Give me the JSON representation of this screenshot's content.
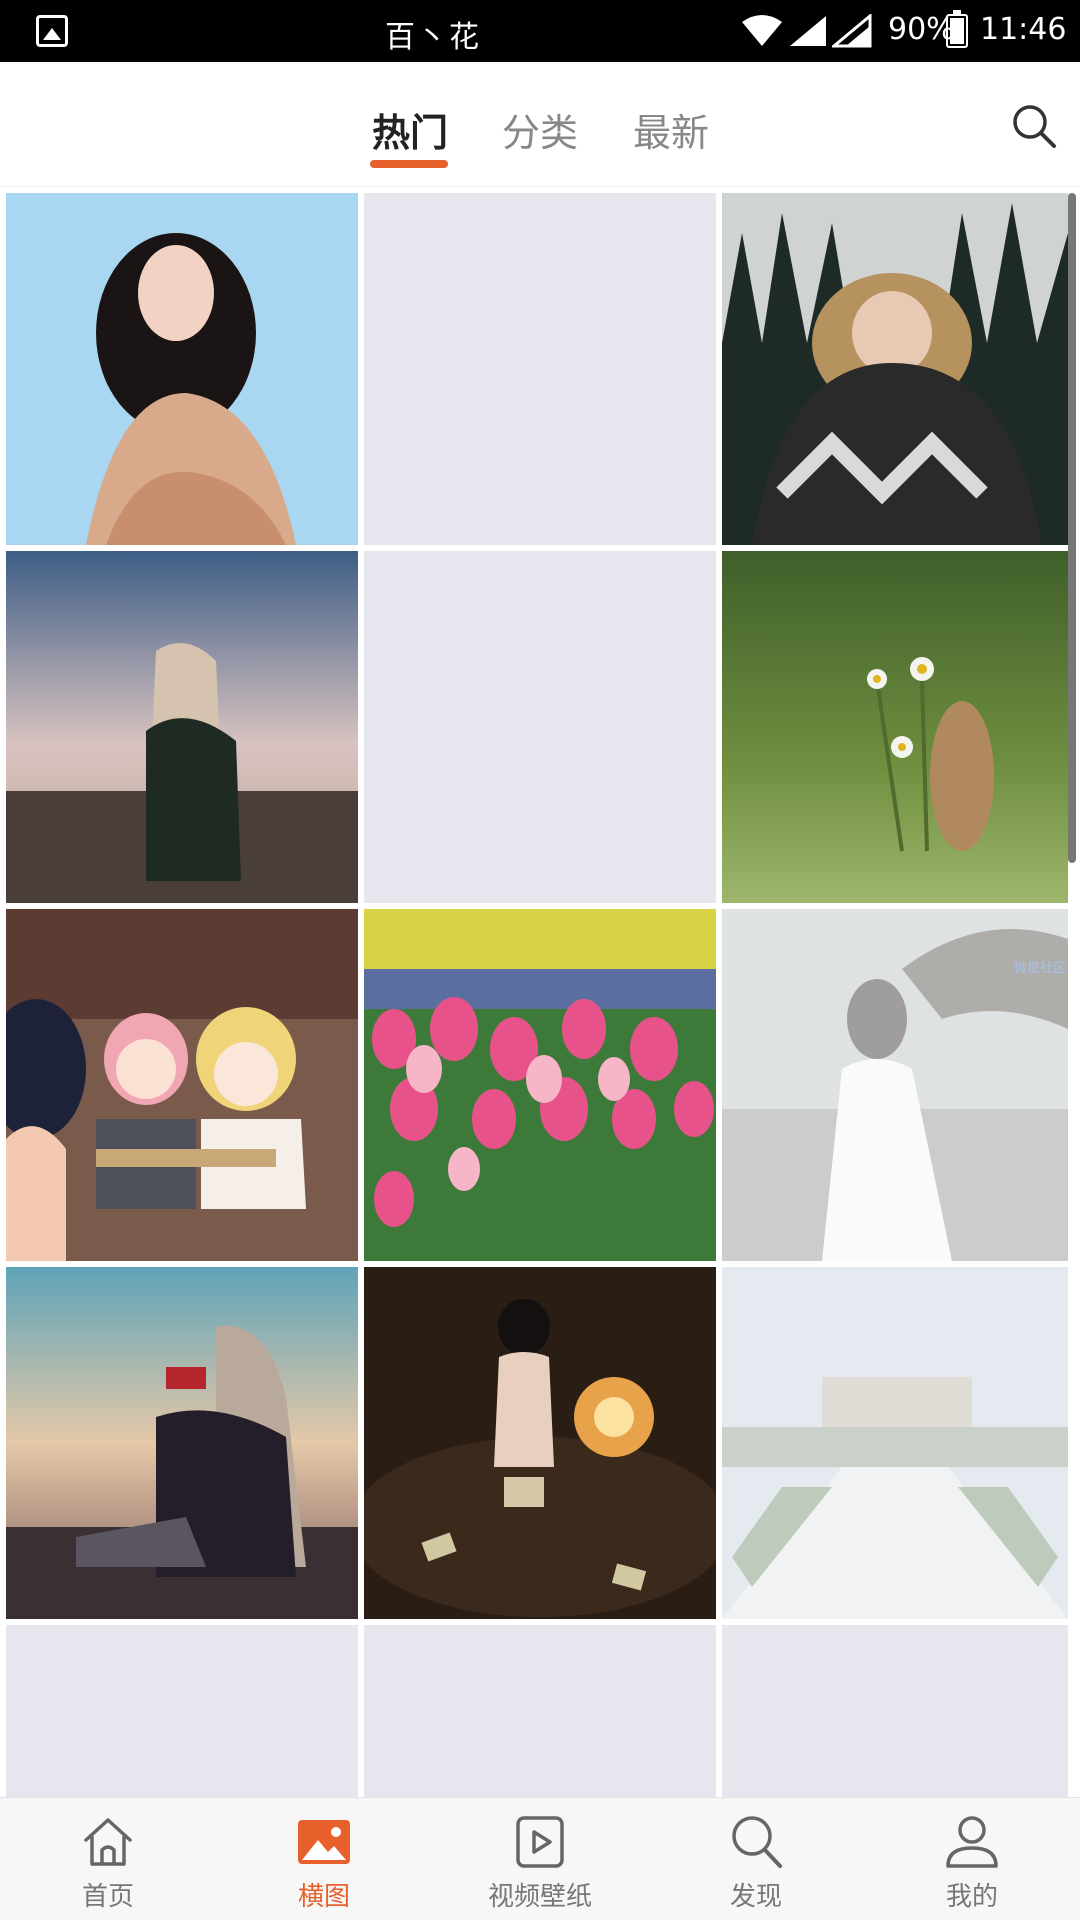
{
  "status_bar": {
    "title": "百丶花",
    "battery": "90%",
    "time": "11:46"
  },
  "top_tabs": {
    "items": [
      "热门",
      "分类",
      "最新"
    ],
    "active_index": 0,
    "search_icon": "search-icon"
  },
  "grid": {
    "watermark": "微星社区",
    "tiles": [
      {
        "subject": "woman-blue-background",
        "loaded": true
      },
      {
        "subject": "placeholder",
        "loaded": false
      },
      {
        "subject": "woman-winter-scarf",
        "loaded": true
      },
      {
        "subject": "girl-sunset-hill",
        "loaded": true
      },
      {
        "subject": "placeholder",
        "loaded": false
      },
      {
        "subject": "squirrel-daisy-green",
        "loaded": true
      },
      {
        "subject": "anime-girls-cafe",
        "loaded": true
      },
      {
        "subject": "pink-tulips",
        "loaded": true
      },
      {
        "subject": "woman-white-hanfu",
        "loaded": true
      },
      {
        "subject": "girl-sitting-sunset",
        "loaded": true
      },
      {
        "subject": "girl-library-dark",
        "loaded": true
      },
      {
        "subject": "palace-garden-faded",
        "loaded": true
      },
      {
        "subject": "placeholder",
        "loaded": false
      },
      {
        "subject": "placeholder",
        "loaded": false
      },
      {
        "subject": "placeholder",
        "loaded": false
      }
    ]
  },
  "bottom_nav": {
    "items": [
      {
        "label": "首页",
        "icon": "home-icon"
      },
      {
        "label": "横图",
        "icon": "image-icon"
      },
      {
        "label": "视频壁纸",
        "icon": "play-icon"
      },
      {
        "label": "发现",
        "icon": "search-icon"
      },
      {
        "label": "我的",
        "icon": "profile-icon"
      }
    ],
    "active_index": 1
  },
  "colors": {
    "accent": "#e8602c",
    "placeholder": "#e6e6ef"
  }
}
